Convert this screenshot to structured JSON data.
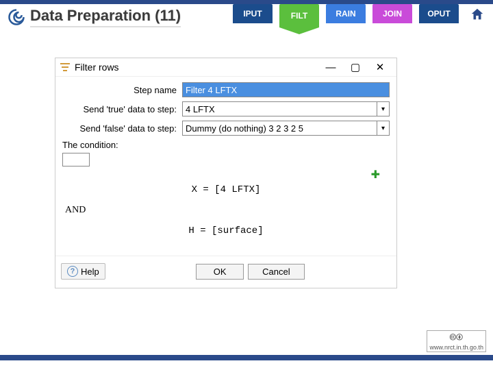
{
  "slide": {
    "title": "Data Preparation (11)"
  },
  "tabs": {
    "iput": "IPUT",
    "filt": "FILT",
    "rain": "RAIN",
    "join": "JOIN",
    "oput": "OPUT"
  },
  "dialog": {
    "title": "Filter rows",
    "step_name_label": "Step name",
    "step_name_value": "Filter 4 LFTX",
    "true_label": "Send 'true' data to step:",
    "true_value": "4 LFTX",
    "false_label": "Send 'false' data to step:",
    "false_value": "Dummy (do nothing) 3 2 3 2 5",
    "condition_label": "The condition:",
    "expr1": "X  =  [4 LFTX]",
    "and": "AND",
    "expr2": "H  =  [surface]",
    "help": "Help",
    "ok": "OK",
    "cancel": "Cancel"
  },
  "footer": {
    "cc_url": "www.nrct.in.th.go.th"
  }
}
